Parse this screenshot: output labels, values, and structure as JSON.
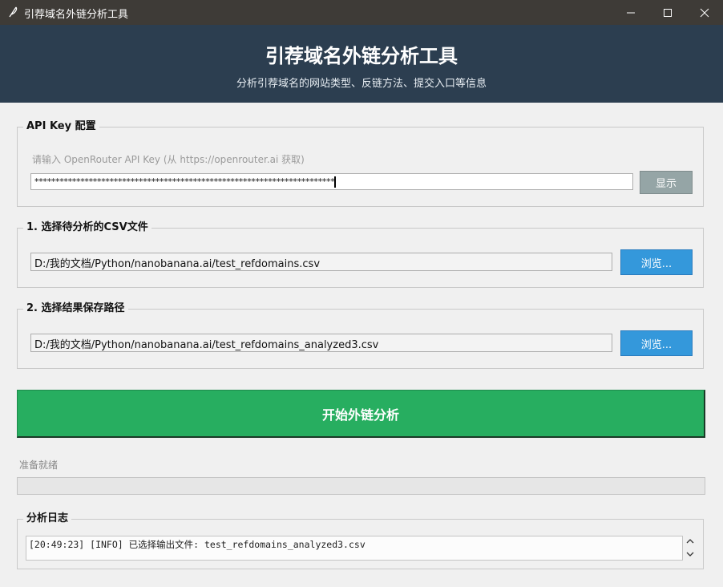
{
  "window": {
    "title": "引荐域名外链分析工具"
  },
  "header": {
    "title": "引荐域名外链分析工具",
    "subtitle": "分析引荐域名的网站类型、反链方法、提交入口等信息"
  },
  "api_key": {
    "legend": "API Key 配置",
    "hint": "请输入 OpenRouter API Key (从 https://openrouter.ai 获取)",
    "value": "************************************************************************",
    "show_label": "显示"
  },
  "csv_input": {
    "legend": "1. 选择待分析的CSV文件",
    "path": "D:/我的文档/Python/nanobanana.ai/test_refdomains.csv",
    "browse_label": "浏览..."
  },
  "output": {
    "legend": "2. 选择结果保存路径",
    "path": "D:/我的文档/Python/nanobanana.ai/test_refdomains_analyzed3.csv",
    "browse_label": "浏览..."
  },
  "start_label": "开始外链分析",
  "status": {
    "text": "准备就绪",
    "progress": 0
  },
  "log": {
    "legend": "分析日志",
    "lines": [
      "[20:49:23] [INFO] 已选择输出文件: test_refdomains_analyzed3.csv"
    ]
  },
  "colors": {
    "header_bg": "#2c3e50",
    "browse_button": "#3498db",
    "show_button": "#95a5a6",
    "start_button": "#27ae60"
  }
}
